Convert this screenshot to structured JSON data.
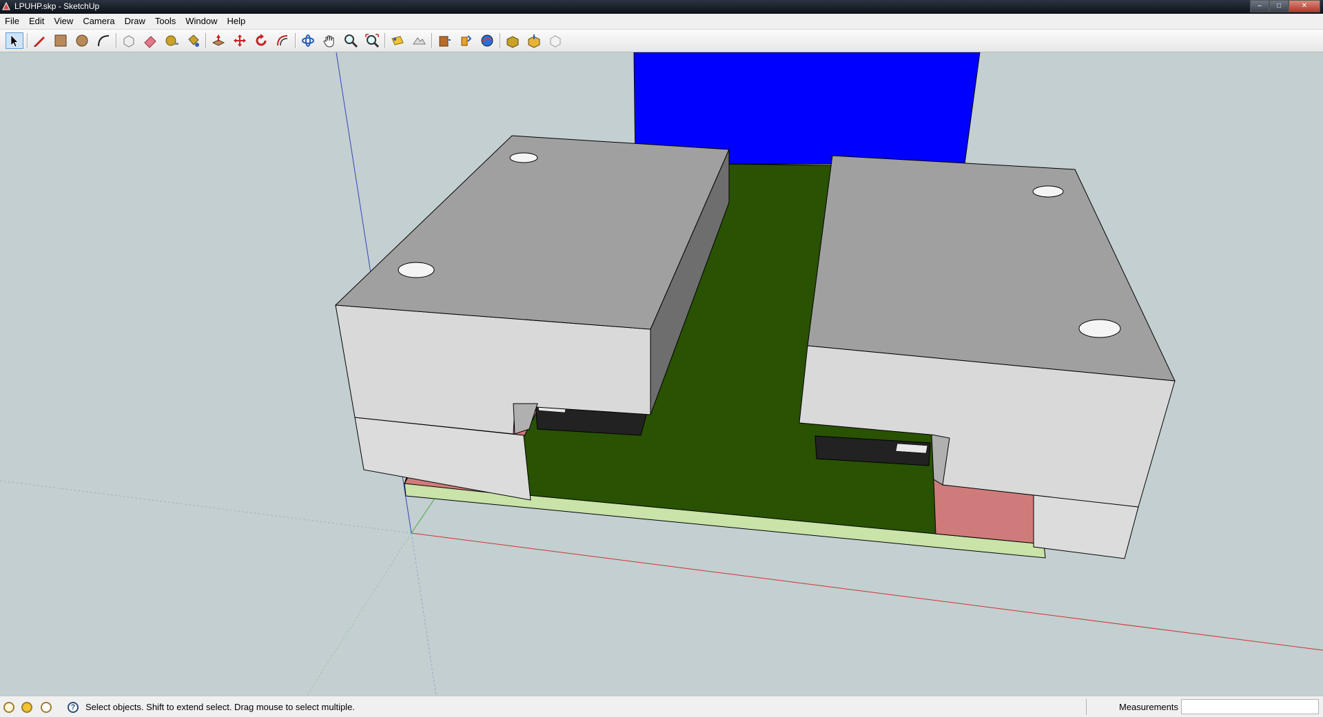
{
  "window": {
    "title": "LPUHP.skp - SketchUp",
    "controls": [
      "minimize-icon",
      "maximize-icon",
      "close-icon"
    ]
  },
  "menubar": {
    "items": [
      {
        "label": "File"
      },
      {
        "label": "Edit"
      },
      {
        "label": "View"
      },
      {
        "label": "Camera"
      },
      {
        "label": "Draw"
      },
      {
        "label": "Tools"
      },
      {
        "label": "Window"
      },
      {
        "label": "Help"
      }
    ]
  },
  "toolbar": {
    "tools": [
      "select-arrow-icon",
      "pencil-line-icon",
      "rectangle-icon",
      "circle-icon",
      "arc-icon",
      "make-component-icon",
      "eraser-icon",
      "tape-measure-icon",
      "paint-bucket-icon",
      "push-pull-icon",
      "move-icon",
      "rotate-icon",
      "offset-icon",
      "orbit-icon",
      "pan-hand-icon",
      "zoom-icon",
      "zoom-extents-icon",
      "add-location-icon",
      "toggle-terrain-icon",
      "get-models-icon",
      "share-model-icon",
      "google-earth-icon",
      "get-components-icon",
      "share-component-icon",
      "extension-warehouse-icon"
    ],
    "active_tool": "select-arrow-icon"
  },
  "scene": {
    "colors": {
      "background": "#c3cfd1",
      "top_face": "#a0a0a0",
      "side_dark": "#707070",
      "side_light": "#d9d9d9",
      "board_green": "#295202",
      "pad_pink": "#d07b7b",
      "board_edge": "#c9e3a8",
      "wall_blue": "#0000ff",
      "chip_black": "#222222",
      "axis_red": "#cc3333",
      "axis_green": "#44aa44",
      "axis_blue": "#3344bb"
    }
  },
  "statusbar": {
    "icons": [
      "geolocation-icon",
      "credits-icon",
      "user-icon",
      "help-question-icon"
    ],
    "message": "Select objects. Shift to extend select. Drag mouse to select multiple.",
    "measurements_label": "Measurements",
    "measurements_value": ""
  }
}
